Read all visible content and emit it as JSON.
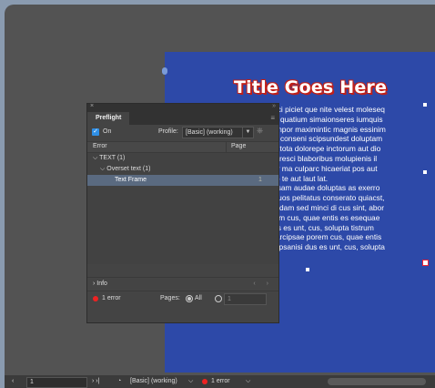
{
  "page": {
    "title": "Title Goes Here",
    "body": "enihici piciet que nite velest moleseq\nuptat quatium simaionseres iumquis\nia tempor maximintic magnis essinim\nm de conseni scipsundest doluptam\nae ni tota dolorepe inctorum aut dio\n, ecs resci blaboribus molupienis il\nestior ma culparc hicaeriat pos aut\naesto te aut laut lat.\nestiosam audae doluptas as exerro\nus, quos pelitatus conserato quiacst,\nbo. Udam sed minci di cus sint, abor\n porem cus, quae entis es esequae\nsi dus es unt, cus, solupta tistrum\nim harcipsae porem cus, quae entis\nodis ipsanisi dus es unt, cus, solupta"
  },
  "preflight": {
    "close": "×",
    "grip": "»",
    "tab": "Preflight",
    "menu": "≡",
    "on_label": "On",
    "profile_label": "Profile:",
    "profile_value": "[Basic] (working)",
    "columns": {
      "error": "Error",
      "page": "Page"
    },
    "tree": [
      {
        "label": "⌵ TEXT (1)",
        "page": "",
        "indent": 6,
        "selected": false
      },
      {
        "label": "⌵ Overset text (1)",
        "page": "",
        "indent": 14,
        "selected": false
      },
      {
        "label": "Text Frame",
        "page": "1",
        "indent": 30,
        "selected": true
      }
    ],
    "info_label": "›   Info",
    "info_nav": "‹ ›",
    "error_count": "1 error",
    "pages_label": "Pages:",
    "all_label": "All",
    "range_value": "1"
  },
  "statusbar": {
    "nav_left": "‹",
    "page": "1",
    "nav_right": "› ›|",
    "profile": "[Basic] (working)",
    "errors": "1 error"
  },
  "colors": {
    "page_blue": "#2d49a8",
    "error_red": "#e22",
    "checkbox_blue": "#2f8fe6"
  }
}
